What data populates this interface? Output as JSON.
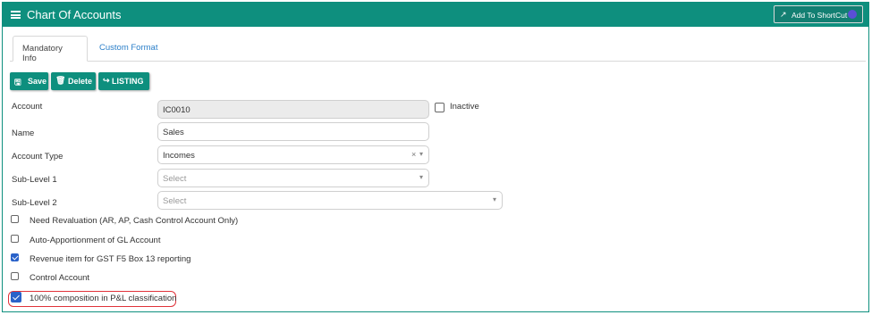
{
  "header": {
    "title": "Chart Of Accounts",
    "shortcut_label": "Add To ShortCut"
  },
  "tabs": [
    {
      "label": "Mandatory Info",
      "active": true
    },
    {
      "label": "Custom Format",
      "active": false
    }
  ],
  "toolbar": {
    "save_label": "Save",
    "delete_label": "Delete",
    "listing_label": "LISTING"
  },
  "form": {
    "account": {
      "label": "Account",
      "value": "IC0010"
    },
    "inactive": {
      "label": "Inactive",
      "checked": false
    },
    "name": {
      "label": "Name",
      "value": "Sales"
    },
    "account_type": {
      "label": "Account Type",
      "value": "Incomes"
    },
    "sub_level_1": {
      "label": "Sub-Level 1",
      "placeholder": "Select"
    },
    "sub_level_2": {
      "label": "Sub-Level 2",
      "placeholder": "Select"
    }
  },
  "options": [
    {
      "label": "Need Revaluation (AR, AP, Cash Control Account Only)",
      "checked": false
    },
    {
      "label": "Auto-Apportionment of GL Account",
      "checked": false
    },
    {
      "label": "Revenue item for GST F5 Box 13 reporting",
      "checked": true
    },
    {
      "label": "Control Account",
      "checked": false
    },
    {
      "label": "100% composition in P&L classification",
      "checked": true
    }
  ],
  "colors": {
    "accent": "#0e8f7e",
    "link": "#2b7fc9",
    "highlight": "#e0333a",
    "checkbox": "#2a62c9"
  },
  "icons": {
    "menu": "hamburger-icon",
    "shortcut": "rocket-icon",
    "save": "floppy-icon",
    "delete": "trash-icon",
    "listing": "sign-out-icon"
  }
}
